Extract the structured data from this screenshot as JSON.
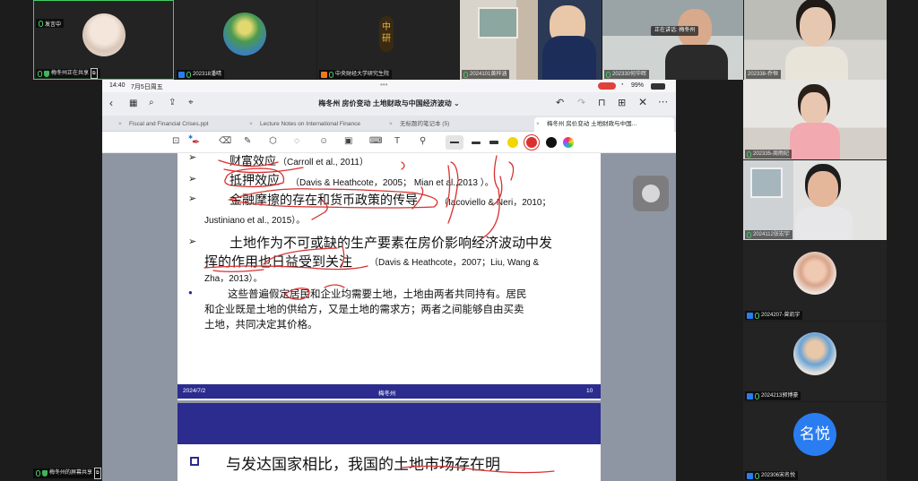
{
  "top_tiles": [
    {
      "label": "梅冬州正在共享",
      "badge": "发言中",
      "kind": "avatar-photo"
    },
    {
      "label": "202318潘晴",
      "kind": "avatar-photo"
    },
    {
      "label": "中央财经大学研究生院",
      "kind": "logo",
      "logo_text": "中研"
    },
    {
      "label": "2024101黄梓涵",
      "kind": "video"
    },
    {
      "label": "202330何华晖",
      "kind": "video",
      "speaking_text": "正在讲话: 梅冬州"
    },
    {
      "label": "202338-乔恒",
      "kind": "video"
    }
  ],
  "bottom_left_label": "梅冬州的屏幕共享",
  "right_tiles": [
    {
      "label": "202335-周雨纪"
    },
    {
      "label": "2024112张宏宇"
    },
    {
      "label": "2024207-曾凯宇"
    },
    {
      "label": "2024213郭博豪"
    },
    {
      "label": "202306宋名悦",
      "name_badge": "名悦"
    }
  ],
  "ipad": {
    "time": "14:40",
    "date": "7月5日周五",
    "battery": "99%",
    "doc_title": "梅冬州 房价变动 土地财政与中国经济波动",
    "tabs": [
      {
        "label": "Fiscal and Financial Crises.ppt"
      },
      {
        "label": "Lecture Notes on International Finance"
      },
      {
        "label": "无标题的笔记本 (5)"
      },
      {
        "label": "梅冬州 房价变动 土地财政与中国..."
      }
    ],
    "colors": {
      "accent": "#d93030",
      "footer": "#2c2c8e",
      "slide_band": "#2c2c8e"
    }
  },
  "slide": {
    "line1_cn": "财富效应",
    "line1_cite": "（Carroll et al., 2011）",
    "line2_cn": "抵押效应",
    "line2_cite": "（Davis & Heathcote，2005； Mian et al.,2013 ）。",
    "line3_cn": "金融摩擦的存在和货币政策的传导",
    "line3_cite": "（Iacoviello & Neri，2010；",
    "line3b": "Justiniano et al., 2015）。",
    "line4a": "土地作为不可或缺的生产要素在房价影响经济波动中发",
    "line4b_cn": "挥的作用也日益受到关注",
    "line4b_cite": "（Davis & Heathcote，2007；Liu, Wang &",
    "line4c": "Zha，2013）。",
    "para1": "这些普遍假定居民和企业均需要土地，土地由两者共同持有。居民",
    "para2": "和企业既是土地的供给方，又是土地的需求方；两者之间能够自由买卖",
    "para3": "土地，共同决定其价格。",
    "footer_date": "2024/7/2",
    "footer_author": "梅冬州",
    "footer_page": "10",
    "next_heading": "与发达国家相比，我国的土地市场存在明"
  }
}
